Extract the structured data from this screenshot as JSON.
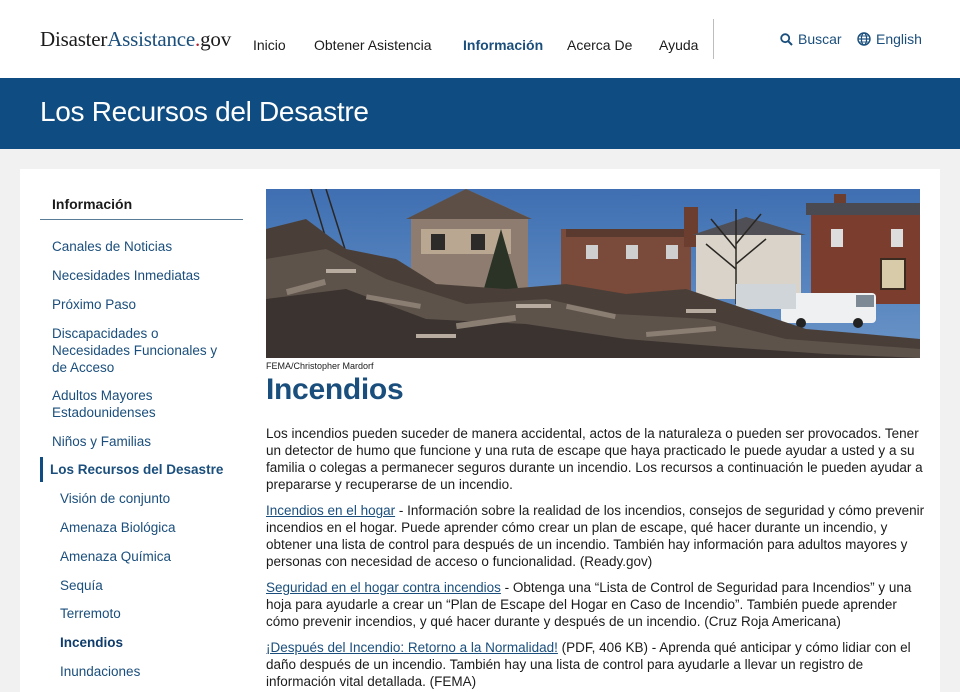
{
  "header": {
    "logo_part1": "Disaster",
    "logo_part2": "Assistance",
    "logo_dot": ".",
    "logo_part3": "gov",
    "nav": [
      "Inicio",
      "Obtener Asistencia",
      "Información",
      "Acerca De",
      "Ayuda"
    ],
    "active_nav": "Información",
    "search_label": "Buscar",
    "language_label": "English"
  },
  "banner": {
    "title": "Los Recursos del Desastre"
  },
  "sidebar": {
    "heading": "Información",
    "items": [
      {
        "label": "Canales de Noticias"
      },
      {
        "label": "Necesidades Inmediatas"
      },
      {
        "label": "Próximo Paso"
      },
      {
        "label": "Discapacidades o Necesidades Funcionales y de Acceso"
      },
      {
        "label": "Adultos Mayores Estadounidenses"
      },
      {
        "label": "Niños y Familias"
      },
      {
        "label": "Los Recursos del Desastre"
      },
      {
        "label": "Visión de conjunto"
      },
      {
        "label": "Amenaza Biológica"
      },
      {
        "label": "Amenaza Química"
      },
      {
        "label": "Sequía"
      },
      {
        "label": "Terremoto"
      },
      {
        "label": "Incendios"
      },
      {
        "label": "Inundaciones"
      }
    ]
  },
  "main": {
    "image_credit": "FEMA/Christopher Mardorf",
    "title": "Incendios",
    "intro": "Los incendios pueden suceder de manera accidental, actos de la naturaleza o pueden ser provocados. Tener un detector de humo que funcione y una ruta de escape que haya practicado le puede ayudar a usted y a su familia o colegas a permanecer seguros durante un incendio. Los recursos a continuación le pueden ayudar a prepararse y recuperarse de un incendio.",
    "resources": [
      {
        "link": "Incendios en el hogar",
        "text": " - Información sobre la realidad de los incendios, consejos de seguridad y cómo prevenir incendios en el hogar. Puede aprender cómo crear un plan de escape, qué hacer durante un incendio, y obtener una lista de control para después de un incendio. También hay información para adultos mayores y personas con necesidad de acceso o funcionalidad. (Ready.gov)"
      },
      {
        "link": "Seguridad en el hogar contra incendios",
        "text": " - Obtenga una “Lista de Control de Seguridad para Incendios” y una hoja para ayudarle a crear un “Plan de Escape del Hogar en Caso de Incendio”. También puede aprender cómo prevenir incendios, y qué hacer durante y después de un incendio. (Cruz Roja Americana)"
      },
      {
        "link": "¡Después del Incendio: Retorno a la Normalidad!",
        "text": " (PDF, 406 KB) - Aprenda qué anticipar y cómo lidiar con el daño después de un incendio. También hay una lista de control para ayudarle a llevar un registro de información vital detallada. (FEMA)"
      }
    ]
  },
  "colors": {
    "primary": "#0f4c81",
    "link": "#1a4e7c",
    "brand_dot": "#b51d2b"
  }
}
